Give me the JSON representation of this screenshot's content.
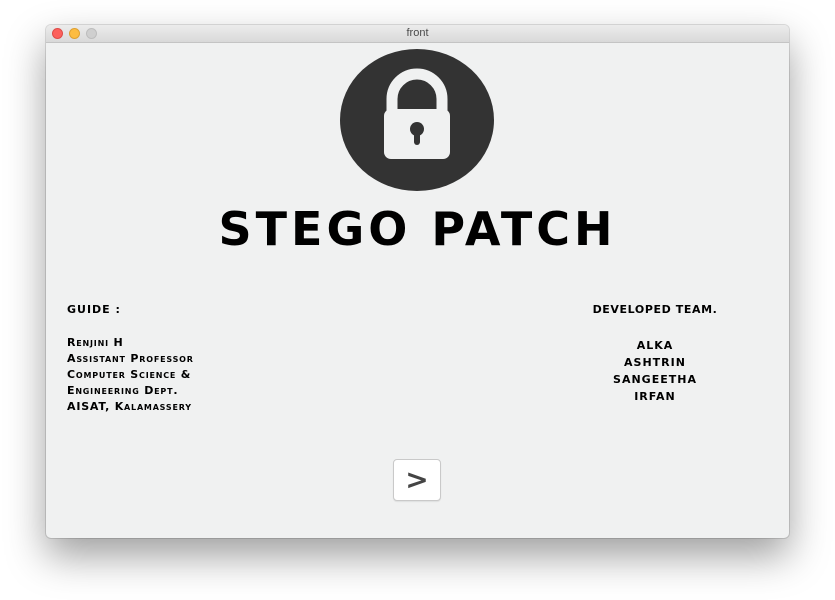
{
  "window": {
    "title": "front"
  },
  "app": {
    "title": "STEGO PATCH",
    "logo_icon": "lock-icon",
    "logo_color": "#333333"
  },
  "guide": {
    "heading": "GUIDE :",
    "lines": [
      "Renjini H",
      "Assistant Professor",
      "Computer Science &",
      "Engineering Dept.",
      "AISAT, Kalamassery"
    ]
  },
  "team": {
    "heading": "DEVELOPED TEAM.",
    "members": [
      "ALKA",
      "ASHTRIN",
      "SANGEETHA",
      "IRFAN"
    ]
  },
  "navigation": {
    "next_label": ">"
  }
}
